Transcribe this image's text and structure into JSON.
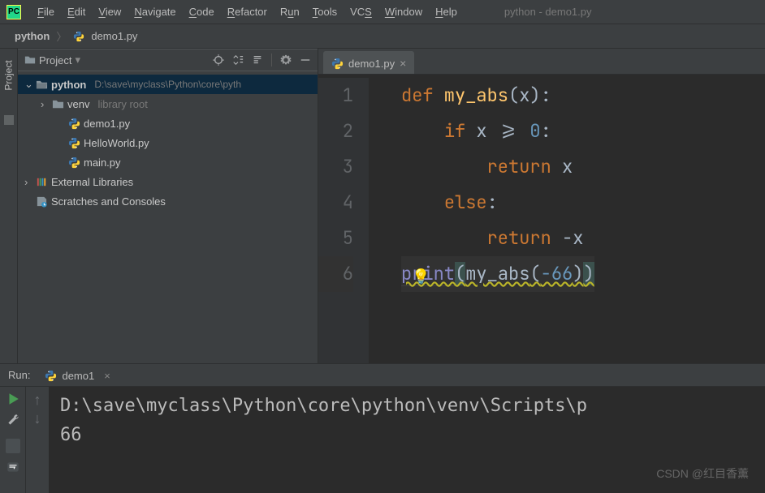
{
  "menubar": {
    "items": [
      {
        "u": "F",
        "rest": "ile"
      },
      {
        "u": "E",
        "rest": "dit"
      },
      {
        "u": "V",
        "rest": "iew"
      },
      {
        "u": "N",
        "rest": "avigate"
      },
      {
        "u": "C",
        "rest": "ode"
      },
      {
        "u": "R",
        "rest": "efactor"
      },
      {
        "u": "",
        "pre": "R",
        "urest": "u",
        "post": "n"
      },
      {
        "u": "T",
        "rest": "ools"
      },
      {
        "u": "",
        "pre": "VC",
        "urest": "S",
        "post": ""
      },
      {
        "u": "W",
        "rest": "indow"
      },
      {
        "u": "H",
        "rest": "elp"
      }
    ],
    "title": "python - demo1.py"
  },
  "breadcrumb": {
    "root": "python",
    "file": "demo1.py"
  },
  "panel": {
    "title": "Project",
    "tree": {
      "root": {
        "name": "python",
        "path": "D:\\save\\myclass\\Python\\core\\pyth"
      },
      "venv": {
        "name": "venv",
        "tag": "library root"
      },
      "files": [
        "demo1.py",
        "HelloWorld.py",
        "main.py"
      ],
      "ext": "External Libraries",
      "scratch": "Scratches and Consoles"
    }
  },
  "editor": {
    "tab": "demo1.py",
    "lines": [
      "1",
      "2",
      "3",
      "4",
      "5",
      "6"
    ],
    "code": {
      "l1": {
        "kw": "def",
        "fn": " my_abs",
        "paren1": "(",
        "param": "x",
        "paren2": ")",
        "colon": ":"
      },
      "l2": {
        "kw": "if",
        "cond": " x >= ",
        "num": "0",
        "colon": ":"
      },
      "l3": {
        "kw": "return",
        "var": " x"
      },
      "l4": {
        "kw": "else",
        "colon": ":"
      },
      "l5": {
        "kw": "return",
        "var": " -x"
      },
      "l6": {
        "fn": "print",
        "p1": "(",
        "call": "my_abs",
        "p2": "(",
        "arg": "-66",
        "p3": ")",
        "p4": ")"
      }
    }
  },
  "run": {
    "label": "Run:",
    "tab": "demo1",
    "console": {
      "path": "D:\\save\\myclass\\Python\\core\\python\\venv\\Scripts\\p",
      "output": "66"
    }
  },
  "rail": {
    "project": "Project"
  },
  "watermark": "CSDN @红目香薰"
}
